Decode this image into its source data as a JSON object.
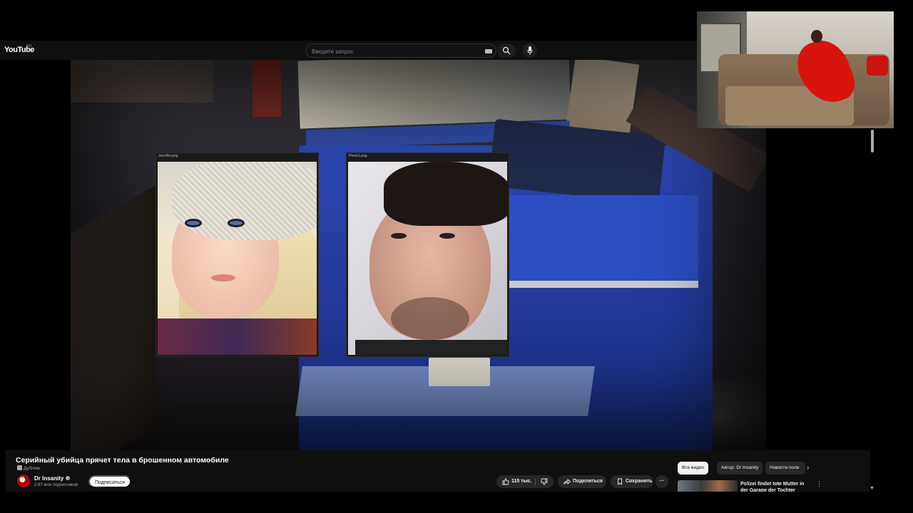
{
  "header": {
    "logo_text": "YouTube",
    "logo_region": "RU",
    "search_placeholder": "Введите запрос"
  },
  "video": {
    "photo_left_title": "Jennifer.png",
    "photo_right_title": "Photo1.png"
  },
  "info": {
    "title": "Серийный убийца прячет тела в брошенном автомобиле",
    "dub_label": "Дубляж",
    "channel_name": "Dr Insanity",
    "subscribers": "2,97 млн подписчиков",
    "subscribe_label": "Подписаться",
    "like_count": "115 тыс.",
    "share_label": "Поделиться",
    "save_label": "Сохранить",
    "more_label": "···"
  },
  "chips": {
    "all": "Все видео",
    "author": "Автор: Dr Insanity",
    "news": "Новости поли",
    "next": "›"
  },
  "recommendation": {
    "title": "Polizei findet tote Mutter in der Garage der Tochter",
    "menu": "⋮"
  },
  "icons": [
    "search-icon",
    "mic-icon",
    "keyboard-icon",
    "like-icon",
    "dislike-icon",
    "share-icon",
    "save-icon",
    "verified-icon",
    "dub-icon"
  ],
  "colors": {
    "background": "#0f0f0f",
    "chip_active": "#f1f1f1",
    "pill": "#272727"
  }
}
